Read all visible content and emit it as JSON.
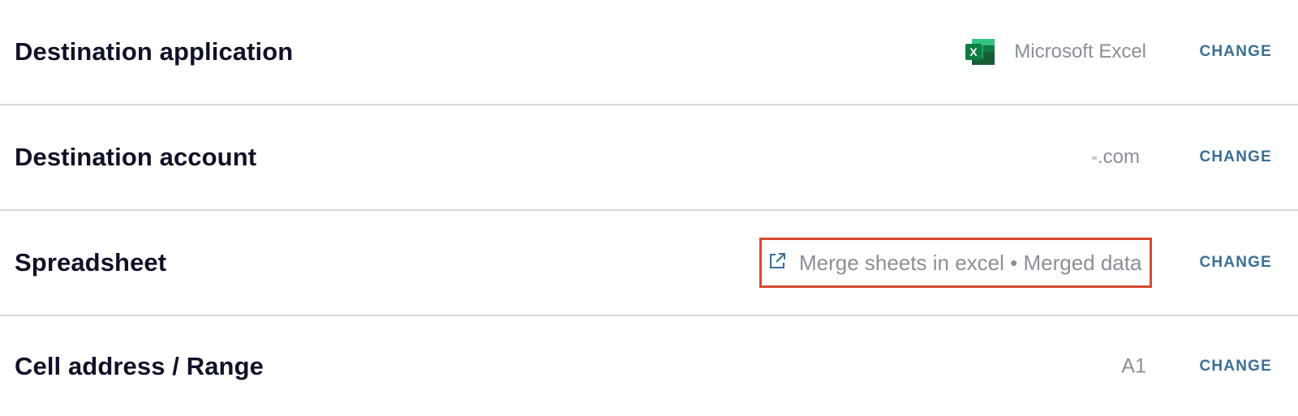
{
  "rows": [
    {
      "label": "Destination application",
      "value": "Microsoft Excel",
      "icon": "excel-icon",
      "change_label": "CHANGE"
    },
    {
      "label": "Destination account",
      "value": ".com",
      "change_label": "CHANGE"
    },
    {
      "label": "Spreadsheet",
      "value": "Merge sheets in excel • Merged data",
      "icon": "external-link-icon",
      "change_label": "CHANGE",
      "highlight_color": "#d64a2e"
    },
    {
      "label": "Cell address / Range",
      "value": "A1",
      "change_label": "CHANGE"
    }
  ],
  "colors": {
    "label": "#0f1226",
    "value": "#8a8f98",
    "change": "#3a6f94",
    "divider": "#d6d8dc",
    "excel_green": "#1e7145"
  }
}
